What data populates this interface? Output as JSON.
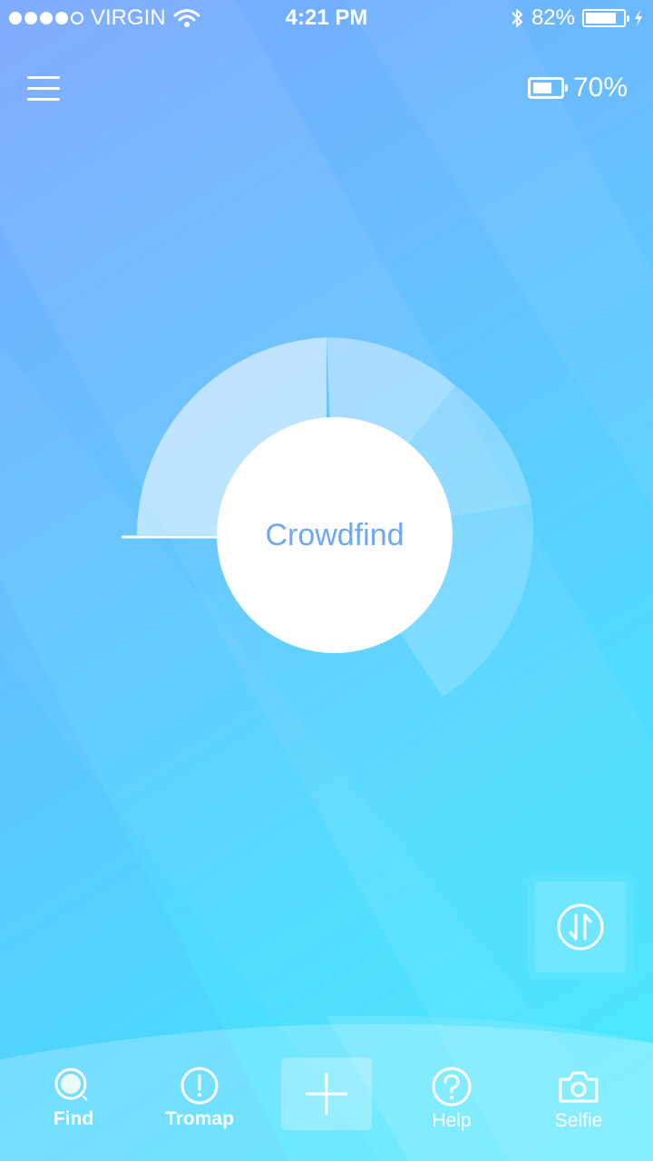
{
  "status_bar": {
    "carrier": "VIRGIN",
    "time": "4:21 PM",
    "battery_percent": "82%",
    "signal_bars_filled": 4,
    "signal_bars_total": 5,
    "battery_level": 0.82,
    "icons": [
      "wifi-icon",
      "bluetooth-icon",
      "battery-icon",
      "charging-bolt-icon"
    ]
  },
  "header": {
    "menu_icon": "hamburger-menu-icon",
    "device_battery_label": "70%",
    "device_battery_level": 0.7
  },
  "main": {
    "center_label": "Crowdfind",
    "swap_icon": "swap-arrows-icon"
  },
  "tab_bar": {
    "tabs": [
      {
        "label": "Find",
        "icon": "search-icon"
      },
      {
        "label": "Tromap",
        "icon": "alert-icon"
      },
      {
        "label": "",
        "icon": "plus-icon"
      },
      {
        "label": "Help",
        "icon": "help-icon"
      },
      {
        "label": "Selfie",
        "icon": "camera-icon"
      }
    ]
  },
  "colors": {
    "background_start": "#7aa6ff",
    "background_end": "#3ce8ff",
    "accent_text": "#6fa8f2",
    "white": "#ffffff"
  }
}
